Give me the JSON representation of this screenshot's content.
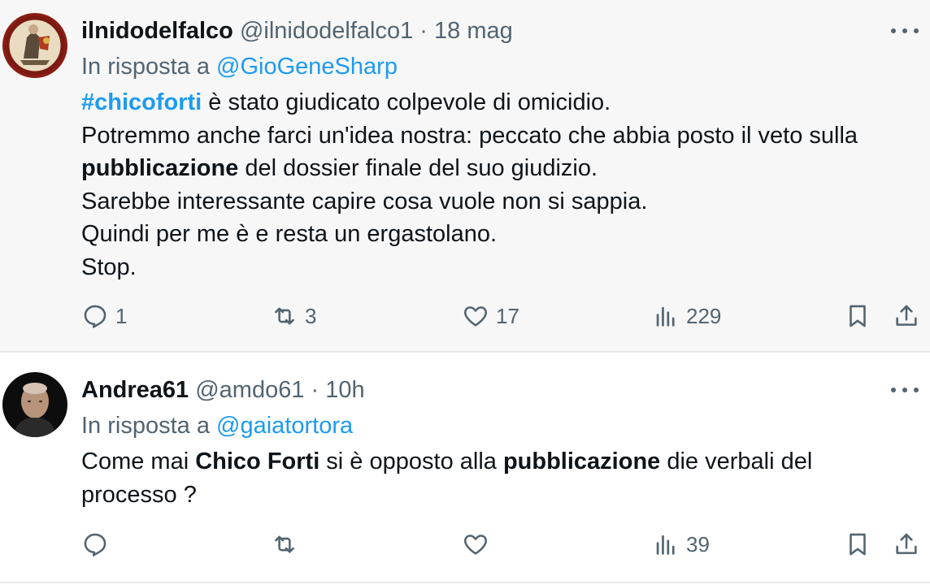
{
  "tweets": [
    {
      "display_name": "ilnidodelfalco",
      "handle": "@ilnidodelfalco1",
      "separator": "·",
      "time": "18 mag",
      "reply_prefix": "In risposta a",
      "reply_to": "@GioGeneSharp",
      "body": {
        "l1_hashtag": "#chicoforti",
        "l1_rest": " è stato giudicato colpevole di omicidio.",
        "l2": "Potremmo anche farci un'idea nostra: peccato che abbia posto il veto sulla",
        "l3_bold": "pubblicazione",
        "l3_rest": " del dossier finale del suo giudizio.",
        "l4": "Sarebbe interessante capire cosa vuole non si sappia.",
        "l5": "Quindi per me è e resta un ergastolano.",
        "l6": "Stop."
      },
      "stats": {
        "replies": "1",
        "reposts": "3",
        "likes": "17",
        "views": "229"
      }
    },
    {
      "display_name": "Andrea61",
      "handle": "@amdo61",
      "separator": "·",
      "time": "10h",
      "reply_prefix": "In risposta a",
      "reply_to": "@gaiatortora",
      "body": {
        "l1_a": "Come mai ",
        "l1_bold1": "Chico Forti",
        "l1_b": " si è opposto alla ",
        "l1_bold2": "pubblicazione",
        "l1_c": " die verbali del",
        "l2": "processo ?"
      },
      "stats": {
        "views": "39"
      }
    }
  ],
  "icons": {
    "reply": "reply-icon",
    "repost": "repost-icon",
    "like": "heart-icon",
    "views": "views-icon",
    "bookmark": "bookmark-icon",
    "share": "share-icon",
    "more": "more-icon"
  },
  "colors": {
    "link": "#1d9bf0",
    "secondary": "#536471",
    "text": "#0f1419"
  }
}
